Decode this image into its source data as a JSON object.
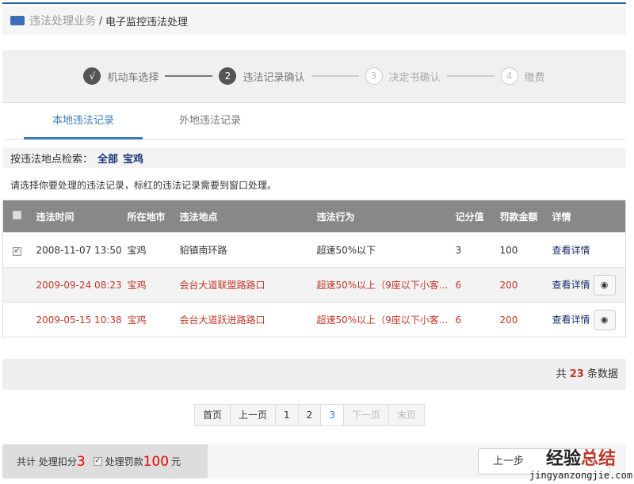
{
  "breadcrumb": {
    "section": "违法处理业务",
    "separator": "/",
    "current": "电子监控违法处理"
  },
  "steps": [
    {
      "marker": "√",
      "label": "机动车选择",
      "state": "done"
    },
    {
      "marker": "2",
      "label": "违法记录确认",
      "state": "active"
    },
    {
      "marker": "3",
      "label": "决定书确认",
      "state": "pending"
    },
    {
      "marker": "4",
      "label": "缴费",
      "state": "pending"
    }
  ],
  "tabs": [
    {
      "label": "本地违法记录",
      "active": true
    },
    {
      "label": "外地违法记录",
      "active": false
    }
  ],
  "filter": {
    "label": "按违法地点检索：",
    "options": [
      "全部",
      "宝鸡"
    ]
  },
  "hint": "请选择你要处理的违法记录，标红的违法记录需要到窗口处理。",
  "table": {
    "headers": [
      "违法时间",
      "所在地市",
      "违法地点",
      "违法行为",
      "记分值",
      "罚款金额",
      "详情"
    ],
    "rows": [
      {
        "checked": true,
        "red": false,
        "time": "2008-11-07 13:50",
        "city": "宝鸡",
        "place": "貂镇南环路",
        "act": "超速50%以下",
        "points": "3",
        "fine": "100",
        "detail": "查看详情",
        "pin": false
      },
      {
        "checked": false,
        "red": true,
        "time": "2009-09-24 08:23",
        "city": "宝鸡",
        "place": "会台大道联盟路路口",
        "act": "超速50%以上（9座以下小客...",
        "points": "6",
        "fine": "200",
        "detail": "查看详情",
        "pin": true
      },
      {
        "checked": false,
        "red": true,
        "time": "2009-05-15 10:38",
        "city": "宝鸡",
        "place": "会台大道跃进路路口",
        "act": "超速50%以上（9座以下小客...",
        "points": "6",
        "fine": "200",
        "detail": "查看详情",
        "pin": true
      }
    ]
  },
  "summary": {
    "prefix": "共",
    "count": "23",
    "suffix": "条数据"
  },
  "pager": {
    "first": "首页",
    "prev": "上一页",
    "pages": [
      "1",
      "2",
      "3"
    ],
    "current": "3",
    "next": "下一页",
    "last": "末页"
  },
  "bottom": {
    "total_label": "共计 处理扣分",
    "points": "3",
    "fine_label": "处理罚款",
    "fine": "100",
    "unit": "元",
    "prev_button": "上一步"
  },
  "watermark": {
    "text": "经验总结",
    "url": "jingyanzongjie.com"
  },
  "colors": {
    "accent": "#3a7cc2",
    "red": "#c0392b",
    "header": "#888888"
  }
}
